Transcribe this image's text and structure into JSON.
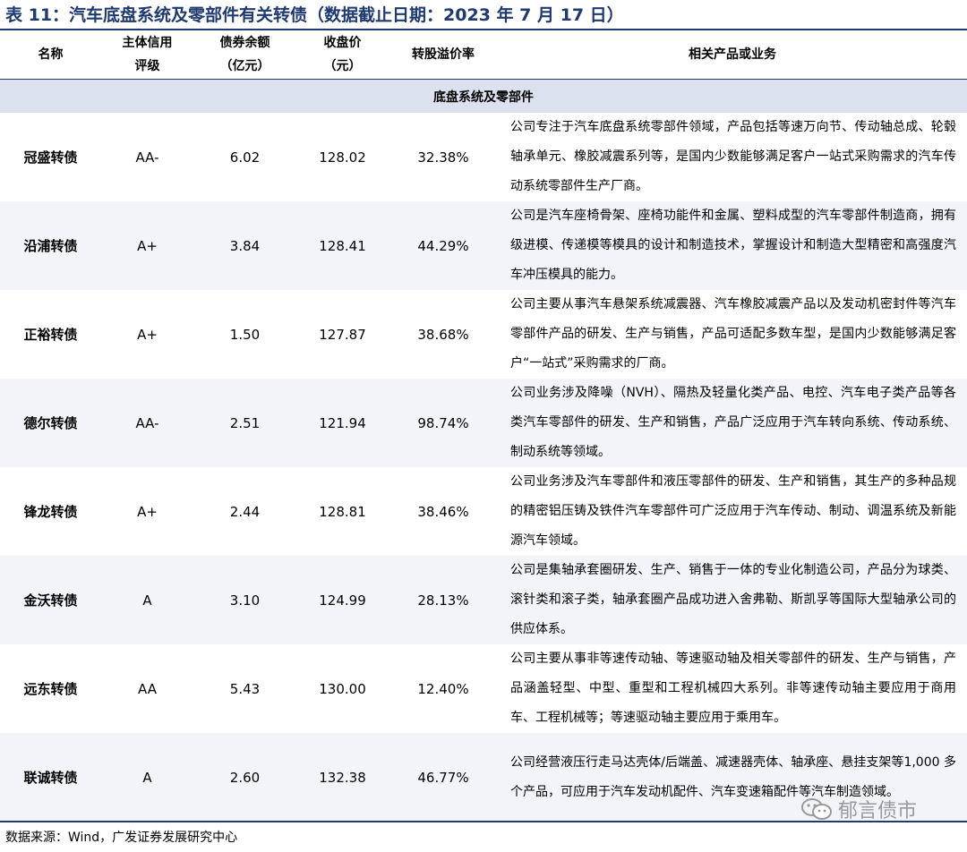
{
  "title": "表 11：汽车底盘系统及零部件有关转债（数据截止日期：2023 年 7 月 17 日）",
  "headers": {
    "name": "名称",
    "rating_l1": "主体信用",
    "rating_l2": "评级",
    "balance_l1": "债券余额",
    "balance_l2": "（亿元）",
    "price_l1": "收盘价",
    "price_l2": "（元）",
    "premium": "转股溢价率",
    "business": "相关产品或业务"
  },
  "section": "底盘系统及零部件",
  "rows": [
    {
      "name": "冠盛转债",
      "rating": "AA-",
      "balance": "6.02",
      "price": "128.02",
      "premium": "32.38%",
      "business": "公司专注于汽车底盘系统零部件领域，产品包括等速万向节、传动轴总成、轮毂轴承单元、橡胶减震系列等，是国内少数能够满足客户一站式采购需求的汽车传动系统零部件生产厂商。"
    },
    {
      "name": "沿浦转债",
      "rating": "A+",
      "balance": "3.84",
      "price": "128.41",
      "premium": "44.29%",
      "business": "公司是汽车座椅骨架、座椅功能件和金属、塑料成型的汽车零部件制造商，拥有级进模、传递模等模具的设计和制造技术，掌握设计和制造大型精密和高强度汽车冲压模具的能力。"
    },
    {
      "name": "正裕转债",
      "rating": "A+",
      "balance": "1.50",
      "price": "127.87",
      "premium": "38.68%",
      "business": "公司主要从事汽车悬架系统减震器、汽车橡胶减震产品以及发动机密封件等汽车零部件产品的研发、生产与销售，产品可适配多数车型，是国内少数能够满足客户“一站式”采购需求的厂商。"
    },
    {
      "name": "德尔转债",
      "rating": "AA-",
      "balance": "2.51",
      "price": "121.94",
      "premium": "98.74%",
      "business": "公司业务涉及降噪（NVH）、隔热及轻量化类产品、电控、汽车电子类产品等各类汽车零部件的研发、生产和销售，产品广泛应用于汽车转向系统、传动系统、制动系统等领域。"
    },
    {
      "name": "锋龙转债",
      "rating": "A+",
      "balance": "2.44",
      "price": "128.81",
      "premium": "38.46%",
      "business": "公司业务涉及汽车零部件和液压零部件的研发、生产和销售，其生产的多种品规的精密铝压铸及铁件汽车零部件可广泛应用于汽车传动、制动、调温系统及新能源汽车领域。"
    },
    {
      "name": "金沃转债",
      "rating": "A",
      "balance": "3.10",
      "price": "124.99",
      "premium": "28.13%",
      "business": "公司是集轴承套圈研发、生产、销售于一体的专业化制造公司，产品分为球类、滚针类和滚子类，轴承套圈产品成功进入舍弗勒、斯凯孚等国际大型轴承公司的供应体系。"
    },
    {
      "name": "远东转债",
      "rating": "AA",
      "balance": "5.43",
      "price": "130.00",
      "premium": "12.40%",
      "business": "公司主要从事非等速传动轴、等速驱动轴及相关零部件的研发、生产与销售，产品涵盖轻型、中型、重型和工程机械四大系列。非等速传动轴主要应用于商用车、工程机械等；等速驱动轴主要应用于乘用车。"
    },
    {
      "name": "联诚转债",
      "rating": "A",
      "balance": "2.60",
      "price": "132.38",
      "premium": "46.77%",
      "business": "公司经营液压行走马达壳体/后端盖、减速器壳体、轴承座、悬挂支架等1,000 多个产品，可应用于汽车发动机配件、汽车变速箱配件等汽车制造领域。"
    }
  ],
  "source": "数据来源：Wind，广发证券发展研究中心",
  "watermark": "郁言债市",
  "icons": {
    "watermark": "wechat-icon"
  },
  "colors": {
    "accent": "#1f3a6e",
    "section_bg": "#dce1ef",
    "alt_row_bg": "#f2f4f9"
  }
}
